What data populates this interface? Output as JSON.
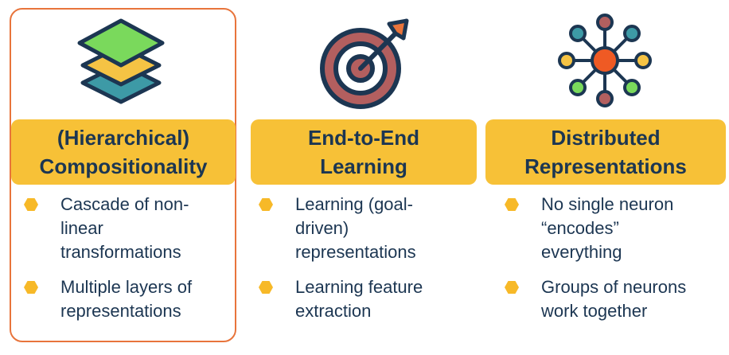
{
  "columns": [
    {
      "heading": "(Hierarchical)\nCompositionality",
      "icon": "layers-icon",
      "bullets": [
        "Cascade of non-\nlinear\ntransformations",
        "Multiple layers of\nrepresentations"
      ]
    },
    {
      "heading": "End-to-End\nLearning",
      "icon": "target-icon",
      "bullets": [
        "Learning (goal-\ndriven)\nrepresentations",
        "Learning feature\nextraction"
      ]
    },
    {
      "heading": "Distributed\nRepresentations",
      "icon": "network-icon",
      "bullets": [
        "No single neuron\n“encodes”\neverything",
        "Groups of neurons\nwork together"
      ]
    }
  ],
  "colors": {
    "banner": "#f7c137",
    "heading_text": "#1c3652",
    "outline": "#e8743b",
    "bullet_dot": "#f7b928"
  }
}
